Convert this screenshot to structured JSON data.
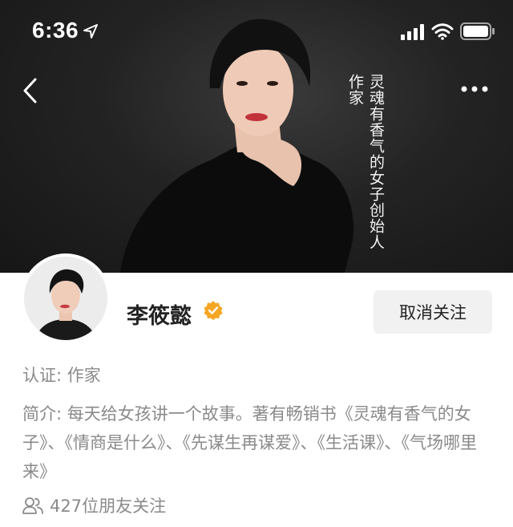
{
  "status_bar": {
    "time": "6:36"
  },
  "icons": {
    "location": "location-arrow-icon",
    "signal": "cellular-signal-icon",
    "wifi": "wifi-icon",
    "battery": "battery-icon",
    "back": "back-chevron-icon",
    "more": "more-dots-icon",
    "verified": "verified-badge-icon",
    "friends": "friends-icon"
  },
  "hero": {
    "role_vertical": "作家",
    "slogan_vertical": "灵魂有香气的女子创始人"
  },
  "profile": {
    "name": "李筱懿",
    "follow_button_label": "取消关注",
    "certification": "认证: 作家",
    "bio": "简介: 每天给女孩讲一个故事。著有畅销书《灵魂有香气的女子》、《情商是什么》、《先谋生再谋爱》、《生活课》、《气场哪里来》",
    "friends_following": "427位朋友关注"
  },
  "colors": {
    "hero_bg": "#1c1c1c",
    "verified_badge": "#f5a623",
    "button_bg": "#f1f1f1",
    "secondary_text": "#8a8a8a"
  }
}
